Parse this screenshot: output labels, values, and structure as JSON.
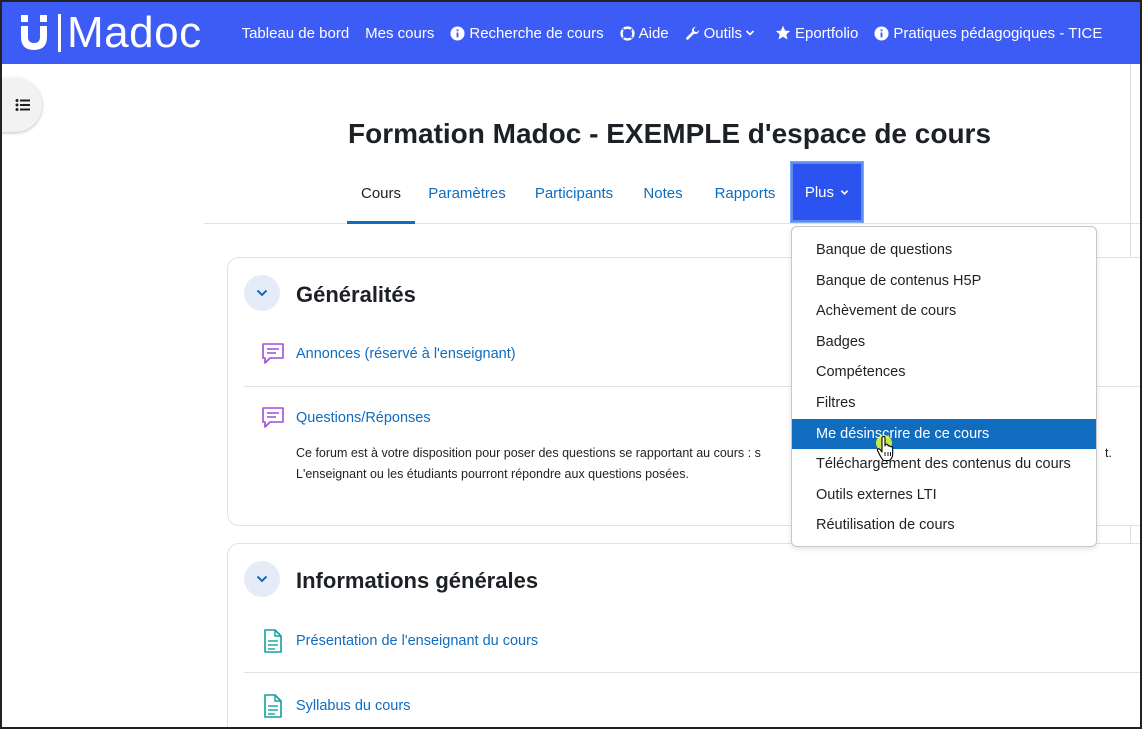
{
  "logo": {
    "text": "Madoc"
  },
  "nav": {
    "items": [
      {
        "label": "Tableau de bord",
        "icon": ""
      },
      {
        "label": "Mes cours",
        "icon": ""
      },
      {
        "label": "Recherche de cours",
        "icon": "info-icon"
      },
      {
        "label": "Aide",
        "icon": "lifebuoy-icon"
      },
      {
        "label": "Outils",
        "icon": "wrench-icon"
      },
      {
        "label": "Eportfolio",
        "icon": "star-icon"
      },
      {
        "label": "Pratiques pédagogiques - TICE",
        "icon": "info-icon"
      }
    ]
  },
  "course": {
    "title": "Formation Madoc - EXEMPLE d'espace de cours"
  },
  "tabs": [
    {
      "label": "Cours"
    },
    {
      "label": "Paramètres"
    },
    {
      "label": "Participants"
    },
    {
      "label": "Notes"
    },
    {
      "label": "Rapports"
    },
    {
      "label": "Plus"
    }
  ],
  "sections": [
    {
      "title": "Généralités",
      "activities": [
        {
          "label": "Annonces (réservé à l'enseignant)",
          "icon": "forum-icon"
        },
        {
          "label": "Questions/Réponses",
          "icon": "forum-icon"
        }
      ],
      "description": [
        "Ce forum est à votre disposition pour poser des questions se rapportant au cours : s",
        "L'enseignant ou les étudiants pourront répondre aux questions posées."
      ],
      "description_tail": "t."
    },
    {
      "title": "Informations générales",
      "activities": [
        {
          "label": "Présentation de l'enseignant du cours",
          "icon": "page-icon"
        },
        {
          "label": "Syllabus du cours",
          "icon": "page-icon"
        }
      ]
    }
  ],
  "dropdown": {
    "items": [
      {
        "label": "Banque de questions"
      },
      {
        "label": "Banque de contenus H5P"
      },
      {
        "label": "Achèvement de cours"
      },
      {
        "label": "Badges"
      },
      {
        "label": "Compétences"
      },
      {
        "label": "Filtres"
      },
      {
        "label": "Me désinscrire de ce cours"
      },
      {
        "label": "Téléchargement des contenus du cours"
      },
      {
        "label": "Outils externes LTI"
      },
      {
        "label": "Réutilisation de cours"
      }
    ],
    "active_index": 6
  },
  "colors": {
    "navbar": "#3d5bf5",
    "link": "#0f6cbf",
    "forum_icon": "#9d4edd",
    "page_icon": "#13a19a"
  }
}
